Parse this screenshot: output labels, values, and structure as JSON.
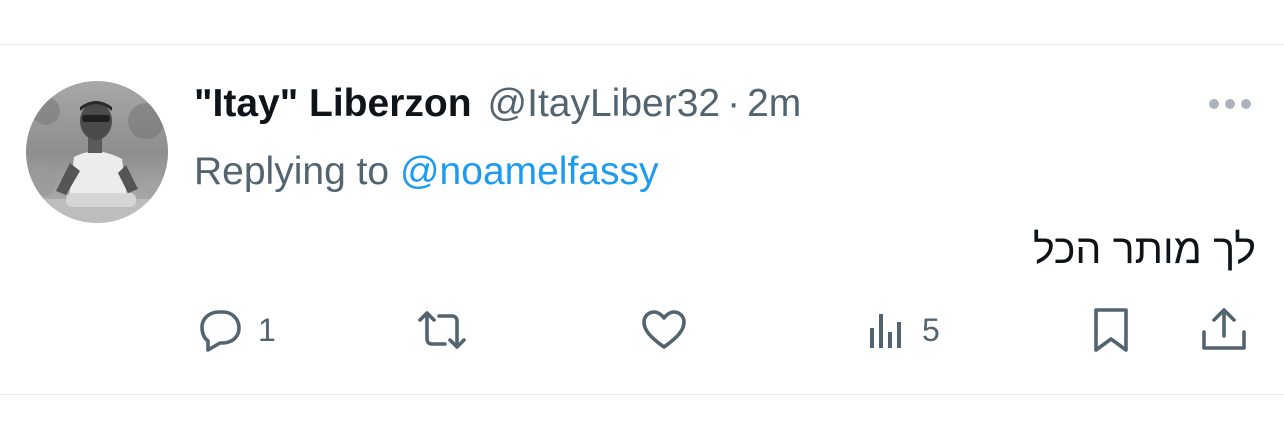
{
  "tweet": {
    "display_name": "\"Itay\" Liberzon",
    "handle": "@ItayLiber32",
    "separator": "·",
    "timestamp": "2m",
    "replying_prefix": "Replying to",
    "replying_to": "@noamelfassy",
    "text": "לך מותר הכל"
  },
  "actions": {
    "reply_count": "1",
    "views_count": "5"
  },
  "icons": {
    "more": "more-horizontal-icon",
    "reply": "reply-bubble-icon",
    "retweet": "retweet-icon",
    "like": "heart-icon",
    "views": "analytics-bars-icon",
    "bookmark": "bookmark-icon",
    "share": "share-upload-icon"
  },
  "colors": {
    "text_primary": "#0f1419",
    "text_secondary": "#536471",
    "link": "#1d9bf0",
    "divider": "#e7e9ea"
  }
}
